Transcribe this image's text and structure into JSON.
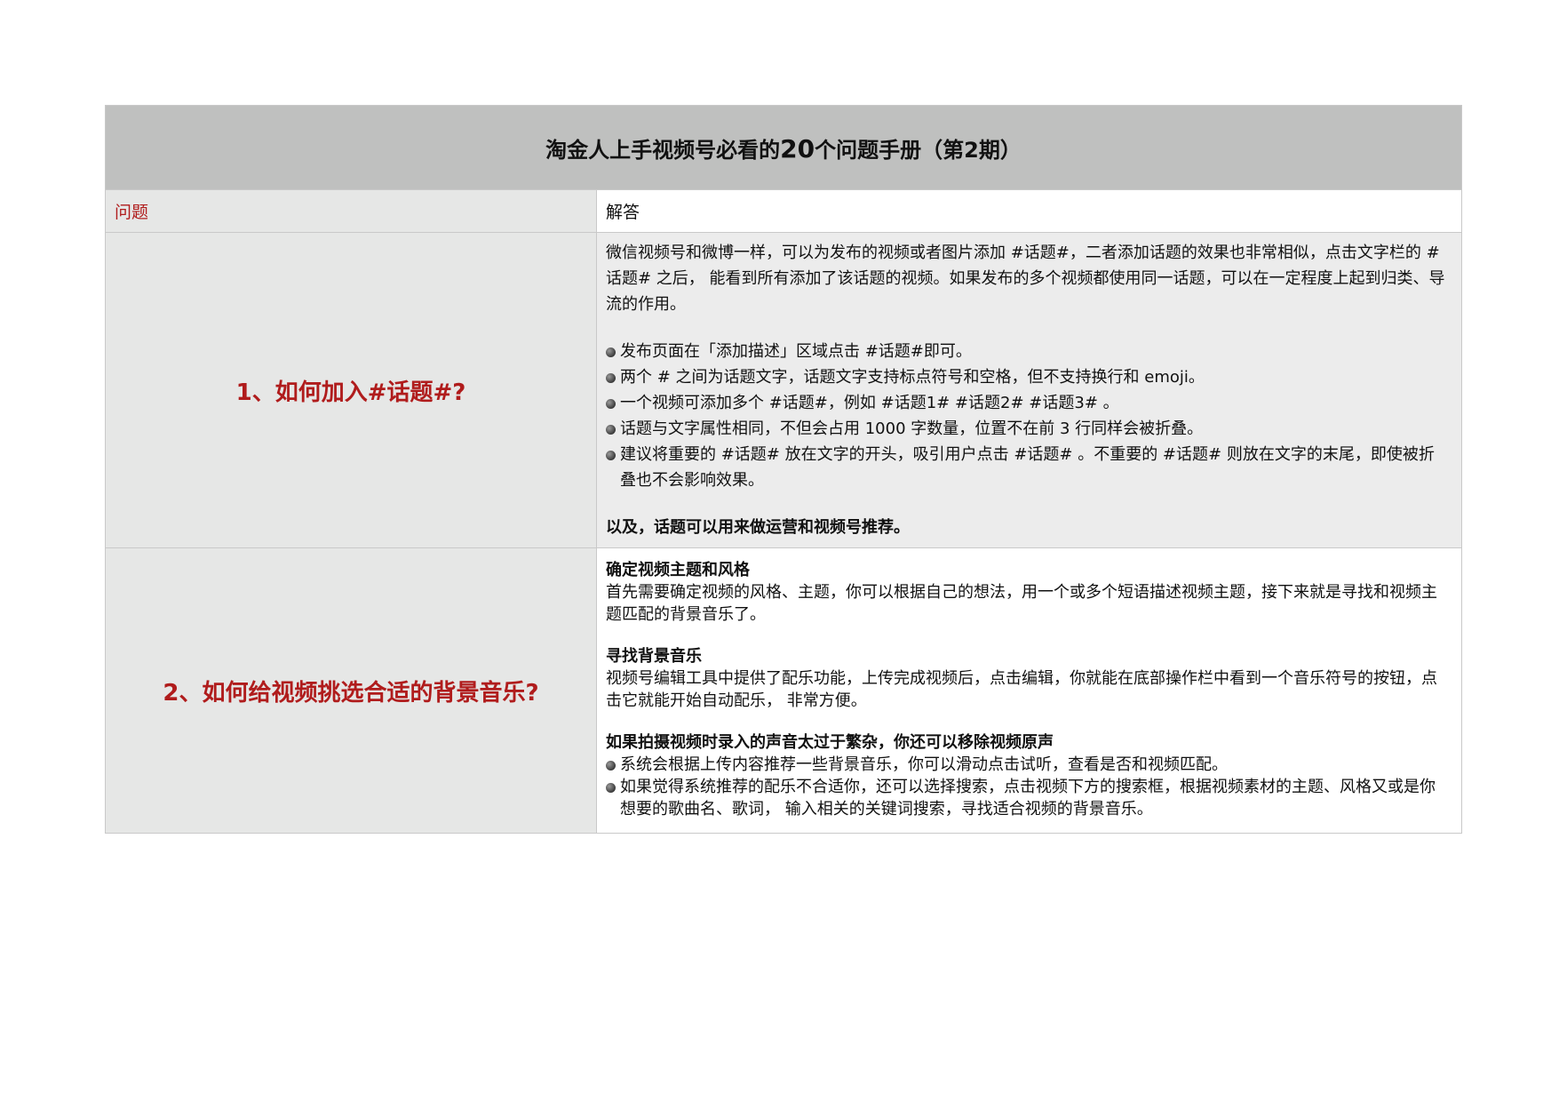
{
  "title_pre": "淘金人上手视频号必看的",
  "title_num": "20",
  "title_post": "个问题手册（第2期）",
  "header": {
    "question": "问题",
    "answer": "解答"
  },
  "q1": {
    "question": "1、如何加入#话题#?",
    "intro": "微信视频号和微博一样，可以为发布的视频或者图片添加 #话题#，二者添加话题的效果也非常相似，点击文字栏的 #话题# 之后， 能看到所有添加了该话题的视频。如果发布的多个视频都使用同一话题，可以在一定程度上起到归类、导流的作用。",
    "bullets": [
      "发布页面在「添加描述」区域点击 #话题#即可。",
      "两个 # 之间为话题文字，话题文字支持标点符号和空格，但不支持换行和 emoji。",
      "一个视频可添加多个 #话题#，例如 #话题1# #话题2# #话题3# 。",
      "话题与文字属性相同，不但会占用 1000 字数量，位置不在前 3 行同样会被折叠。",
      "建议将重要的 #话题# 放在文字的开头，吸引用户点击 #话题# 。不重要的 #话题# 则放在文字的末尾，即使被折叠也不会影响效果。"
    ],
    "closing": "以及，话题可以用来做运营和视频号推荐。"
  },
  "q2": {
    "question": "2、如何给视频挑选合适的背景音乐?",
    "sec1_title": "确定视频主题和风格",
    "sec1_text": "首先需要确定视频的风格、主题，你可以根据自己的想法，用一个或多个短语描述视频主题，接下来就是寻找和视频主题匹配的背景音乐了。",
    "sec2_title": "寻找背景音乐",
    "sec2_text": "视频号编辑工具中提供了配乐功能，上传完成视频后，点击编辑，你就能在底部操作栏中看到一个音乐符号的按钮，点击它就能开始自动配乐， 非常方便。",
    "sec3_title": "如果拍摄视频时录入的声音太过于繁杂，你还可以移除视频原声",
    "bullets": [
      "系统会根据上传内容推荐一些背景音乐，你可以滑动点击试听，查看是否和视频匹配。",
      "如果觉得系统推荐的配乐不合适你，还可以选择搜索，点击视频下方的搜索框，根据视频素材的主题、风格又或是你想要的歌曲名、歌词， 输入相关的关键词搜索，寻找适合视频的背景音乐。"
    ]
  }
}
